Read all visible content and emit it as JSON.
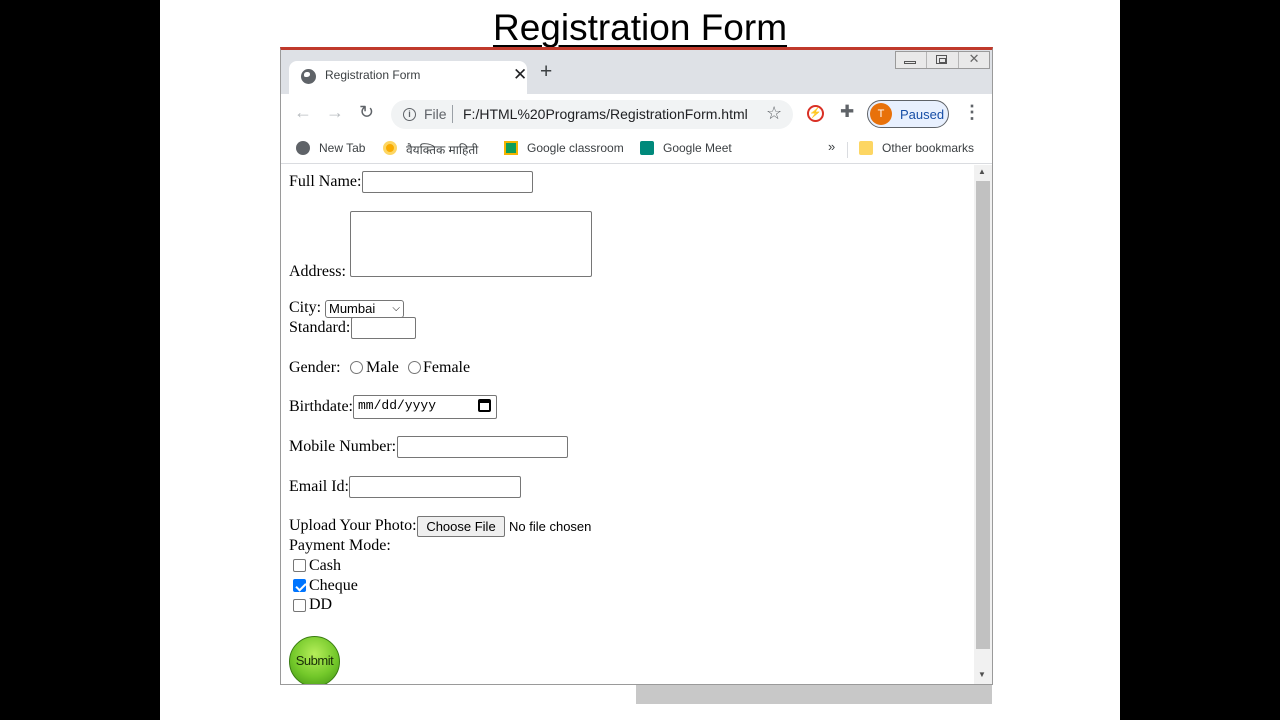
{
  "slide": {
    "title": "Registration Form"
  },
  "browser": {
    "tab_title": "Registration Form",
    "address": {
      "scheme": "File",
      "url": "F:/HTML%20Programs/RegistrationForm.html"
    },
    "profile": {
      "initial": "T",
      "label": "Paused"
    },
    "bookmarks": [
      {
        "label": "New Tab",
        "icon": "globe-icon"
      },
      {
        "label": "वैयक्तिक माहिती",
        "icon": "circle-icon"
      },
      {
        "label": "Google classroom",
        "icon": "classroom-icon"
      },
      {
        "label": "Google Meet",
        "icon": "meet-icon"
      }
    ],
    "more_bookmarks": "»",
    "other_bookmarks": "Other bookmarks"
  },
  "form": {
    "full_name_label": "Full Name:",
    "address_label": "Address:",
    "city_label": "City:",
    "city_selected": "Mumbai",
    "standard_label": "Standard:",
    "gender_label": "Gender:",
    "gender_options": [
      "Male",
      "Female"
    ],
    "birthdate_label": "Birthdate:",
    "birthdate_placeholder": "mm/dd/yyyy",
    "mobile_label": "Mobile Number:",
    "email_label": "Email Id:",
    "photo_label": "Upload Your Photo:",
    "choose_file": "Choose File",
    "no_file": "No file chosen",
    "payment_label": "Payment Mode:",
    "payment_options": [
      {
        "label": "Cash",
        "checked": false
      },
      {
        "label": "Cheque",
        "checked": true
      },
      {
        "label": "DD",
        "checked": false
      }
    ],
    "submit_label": "Submit"
  },
  "colors": {
    "window_accent": "#c0392b",
    "checkbox_checked": "#0075ff",
    "submit_green": "#73c82a",
    "profile_avatar": "#e8710a"
  }
}
